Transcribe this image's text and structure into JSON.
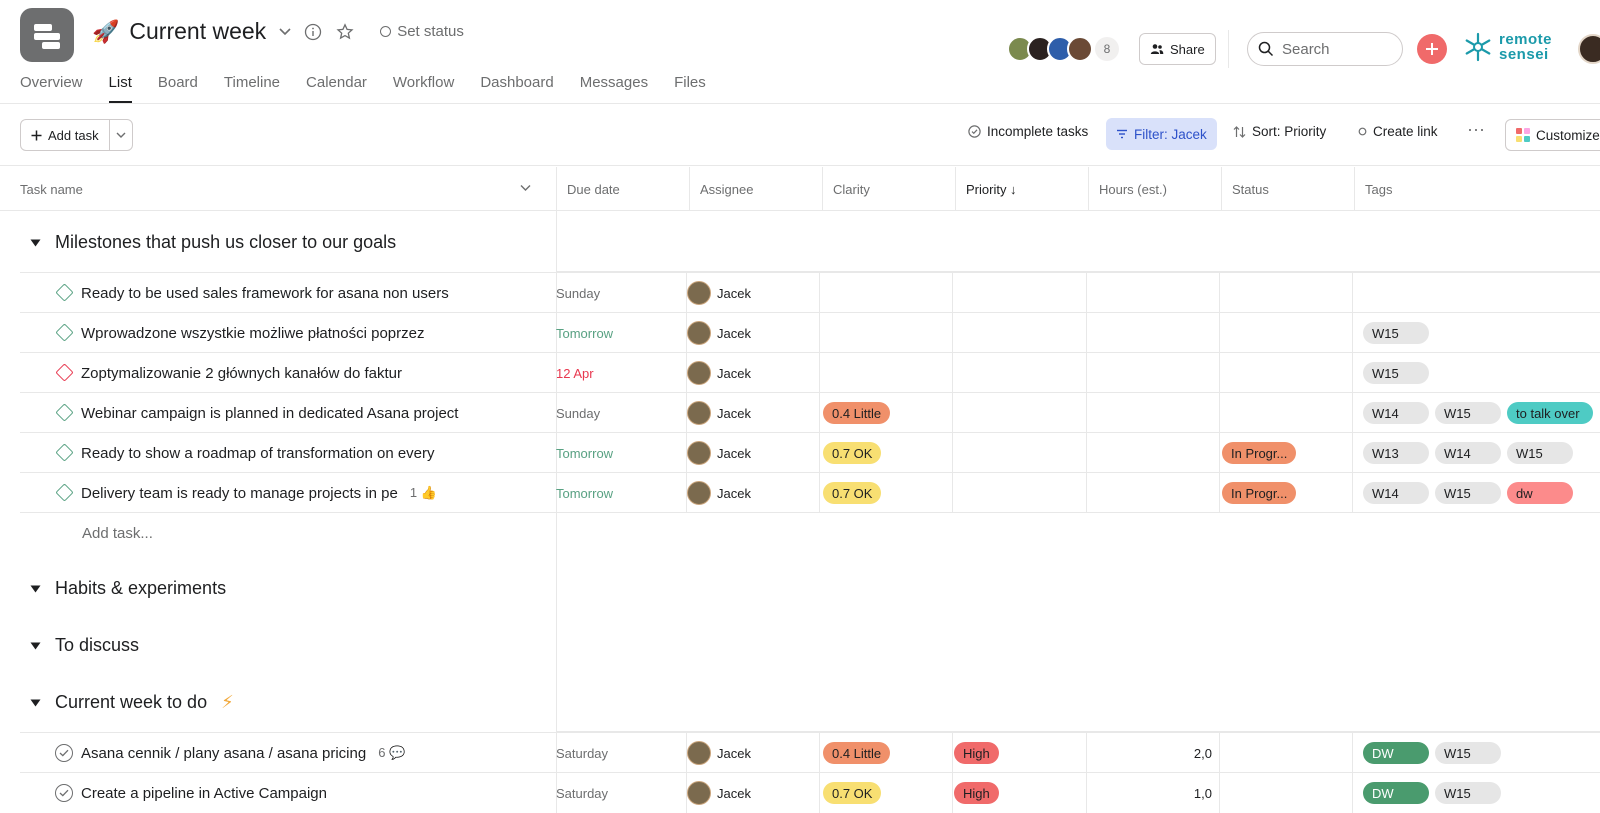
{
  "header": {
    "project_icon": "project-board-icon",
    "emoji": "🚀",
    "title": "Current week",
    "set_status": "Set status",
    "member_count": "8",
    "share_label": "Share",
    "search_placeholder": "Search",
    "logo_line1": "remote",
    "logo_line2": "sensei"
  },
  "tabs": [
    "Overview",
    "List",
    "Board",
    "Timeline",
    "Calendar",
    "Workflow",
    "Dashboard",
    "Messages",
    "Files"
  ],
  "toolbar": {
    "add_task": "Add task",
    "incomplete": "Incomplete tasks",
    "filter": "Filter: Jacek",
    "sort": "Sort: Priority",
    "create_link": "Create link",
    "more": "···",
    "customize": "Customize"
  },
  "columns": {
    "task": "Task name",
    "due": "Due date",
    "assignee": "Assignee",
    "clarity": "Clarity",
    "priority": "Priority ↓",
    "hours": "Hours (est.)",
    "status": "Status",
    "tags": "Tags"
  },
  "colors": {
    "accent": "#f06a6a",
    "done_green": "#58a182",
    "overdue_red": "#e8384f",
    "clarity_little": "#f0906a",
    "clarity_ok": "#f8df72",
    "priority_high": "#f06a6a",
    "status_inprog": "#f0906a",
    "tag_dw": "#4a9b6e",
    "tag_talk": "#4ecbc4",
    "tag_dw_pink": "#fc8b8b",
    "tag_default": "#e6e6e6"
  },
  "sections": [
    {
      "title": "Milestones that push us closer to our goals"
    },
    {
      "title": "Habits & experiments"
    },
    {
      "title": "To discuss"
    },
    {
      "title": "Current week to do",
      "emoji": "⚡"
    }
  ],
  "milestones": [
    {
      "name": "Ready to be used sales framework for asana non users",
      "due": "Sunday",
      "assignee": "Jacek",
      "clarity": "",
      "status": "",
      "tags": []
    },
    {
      "name": "Wprowadzone wszystkie możliwe płatności poprzez",
      "due": "Tomorrow",
      "assignee": "Jacek",
      "clarity": "",
      "status": "",
      "tags": [
        "W15"
      ]
    },
    {
      "name": "Zoptymalizowanie 2 głównych kanałów do faktur",
      "due": "12 Apr",
      "assignee": "Jacek",
      "clarity": "",
      "status": "",
      "tags": [
        "W15"
      ]
    },
    {
      "name": "Webinar campaign is planned in dedicated Asana project",
      "due": "Sunday",
      "assignee": "Jacek",
      "clarity": "0.4 Little",
      "status": "",
      "tags": [
        "W14",
        "W15",
        "to talk over"
      ]
    },
    {
      "name": "Ready to show a roadmap of transformation on every",
      "due": "Tomorrow",
      "assignee": "Jacek",
      "clarity": "0.7 OK",
      "status": "In Progr...",
      "tags": [
        "W13",
        "W14",
        "W15"
      ]
    },
    {
      "name": "Delivery team is ready to manage projects in pe",
      "likes": "1",
      "due": "Tomorrow",
      "assignee": "Jacek",
      "clarity": "0.7 OK",
      "status": "In Progr...",
      "tags": [
        "W14",
        "W15",
        "dw"
      ]
    }
  ],
  "add_task_row": "Add task...",
  "current_week": [
    {
      "name": "Asana cennik / plany asana / asana pricing",
      "comments": "6",
      "due": "Saturday",
      "assignee": "Jacek",
      "clarity": "0.4 Little",
      "priority": "High",
      "hours": "2,0",
      "tags": [
        "DW",
        "W15"
      ]
    },
    {
      "name": "Create a pipeline in Active Campaign",
      "due": "Saturday",
      "assignee": "Jacek",
      "clarity": "0.7 OK",
      "priority": "High",
      "hours": "1,0",
      "tags": [
        "DW",
        "W15"
      ]
    }
  ]
}
